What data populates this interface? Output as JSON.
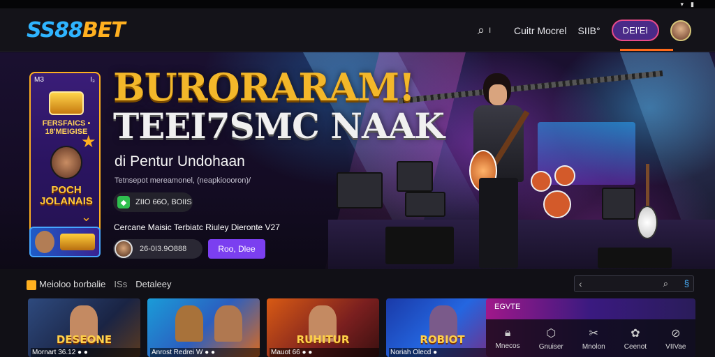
{
  "header": {
    "logo_part1": "SS88",
    "logo_part2": "BET",
    "search_icon": "search-icon",
    "search_suffix": "I",
    "nav_item_1": "Cuitr Mocrel",
    "nav_item_2": "SIIB°",
    "login_label": "DEI'EI",
    "avatar_icon": "user-avatar",
    "accent_color": "#ff6a1a",
    "login_color": "#4a2a88"
  },
  "hero": {
    "headline_line1": "BURORARAM!",
    "headline_line2": "TEEI7SMC NAAK",
    "subheading": "di Pentur Undohaan",
    "tagline": "Tetnsepot mereamonel, (neapkioooron)/",
    "bonus_pill_text": "ZIIO 66O, BOIIS",
    "bonus_icon": "tag-icon",
    "note_text": "Cercane Maisic Terbiatc Riuley Dieronte V27",
    "user_pill_text": "26-0I3.9O888",
    "play_button": "Roo, Dlee",
    "promo_card": {
      "corner_left": "M3",
      "corner_right": "I₃",
      "subtitle": "FERSFAICS ▪ 18'MEIGISE",
      "title": "POCH JOLANAIS"
    }
  },
  "section": {
    "category_title": "Meioloo borbalie",
    "category_divider": "ISs",
    "category_link": "Detaleey",
    "search_left": "‹",
    "search_icon": "search-icon",
    "search_extra": "§",
    "games": [
      {
        "big": "DESEONE",
        "label": "Mornart 36.12 ● ●"
      },
      {
        "big": "",
        "label": "Anrost Redrei W ● ●"
      },
      {
        "big": "RUHITUR",
        "label": "Mauot 66 ● ●"
      },
      {
        "big": "ROBIOT",
        "label": "Noriah Olecd ●"
      }
    ],
    "side_panel_title": "EGVTE",
    "side_items": [
      {
        "icon": "lock-icon",
        "label": "Mnecos"
      },
      {
        "icon": "cube-icon",
        "label": "Gnuiser"
      },
      {
        "icon": "scissors-icon",
        "label": "Mnolon"
      },
      {
        "icon": "gift-icon",
        "label": "Ceenot"
      },
      {
        "icon": "ban-icon",
        "label": "VIIVae"
      }
    ]
  }
}
